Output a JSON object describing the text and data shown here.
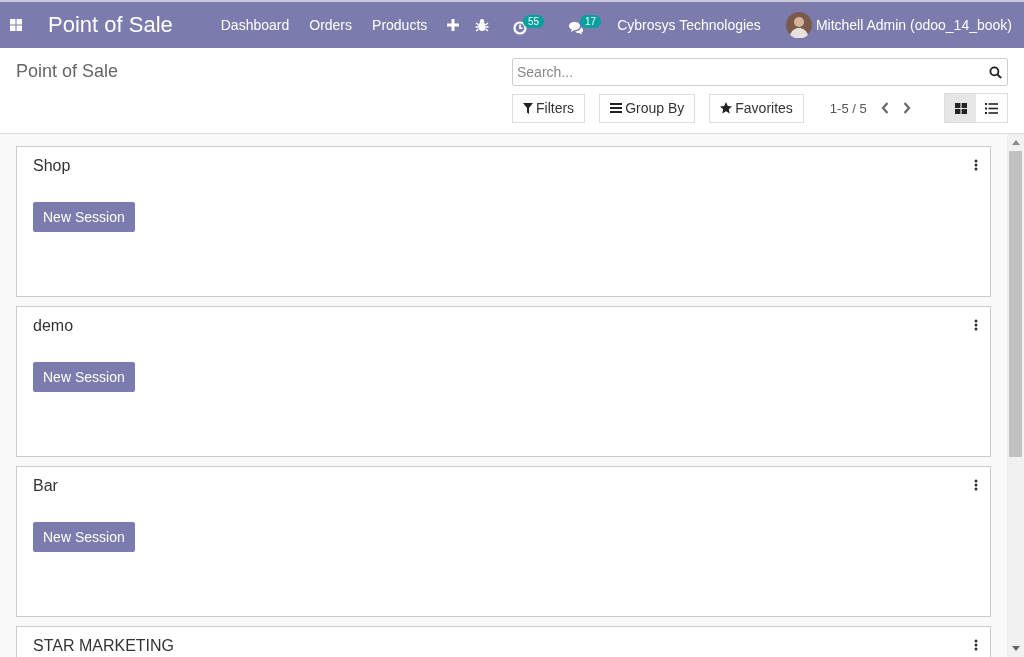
{
  "navbar": {
    "app_title": "Point of Sale",
    "menu": [
      "Dashboard",
      "Orders",
      "Products"
    ],
    "activity_count": "55",
    "message_count": "17",
    "company": "Cybrosys Technologies",
    "user": "Mitchell Admin (odoo_14_book)"
  },
  "control_panel": {
    "breadcrumb": "Point of Sale",
    "search": {
      "placeholder": "Search..."
    },
    "filters": [
      "Filters",
      "Group By",
      "Favorites"
    ],
    "pager": "1-5 / 5",
    "views": [
      {
        "kind": "kanban",
        "selected": true
      },
      {
        "kind": "list",
        "selected": false
      }
    ]
  },
  "cards": [
    {
      "name": "Shop",
      "button": "New Session"
    },
    {
      "name": "demo",
      "button": "New Session"
    },
    {
      "name": "Bar",
      "button": "New Session"
    },
    {
      "name": "STAR MARKETING"
    }
  ]
}
